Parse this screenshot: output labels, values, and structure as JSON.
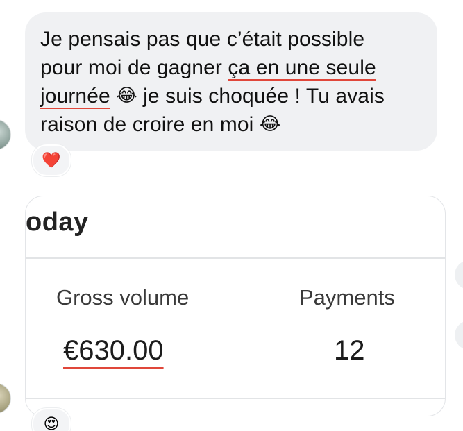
{
  "message": {
    "line1": "Je pensais pas que c’était possible",
    "line2_prefix": "pour moi de gagner ",
    "line2_underlined": "ça en une seule",
    "line3_underlined": "journée",
    "line3_suffix": " je suis choquée ! Tu avais",
    "line4": "raison de croire en moi",
    "emoji_1": "😂",
    "emoji_2": "😂",
    "underline_color": "#e0473a"
  },
  "reactions": [
    {
      "emoji": "❤️",
      "icon": "heart-icon"
    },
    {
      "emoji": "😍",
      "icon": "heart-eyes-icon"
    }
  ],
  "card": {
    "title": "oday",
    "metrics": [
      {
        "label": "Gross volume",
        "value": "€630.00"
      },
      {
        "label": "Payments",
        "value": "12"
      }
    ]
  },
  "colors": {
    "bubble_background": "#f0f1f3",
    "accent_underline": "#e0473a",
    "text": "#111111"
  }
}
